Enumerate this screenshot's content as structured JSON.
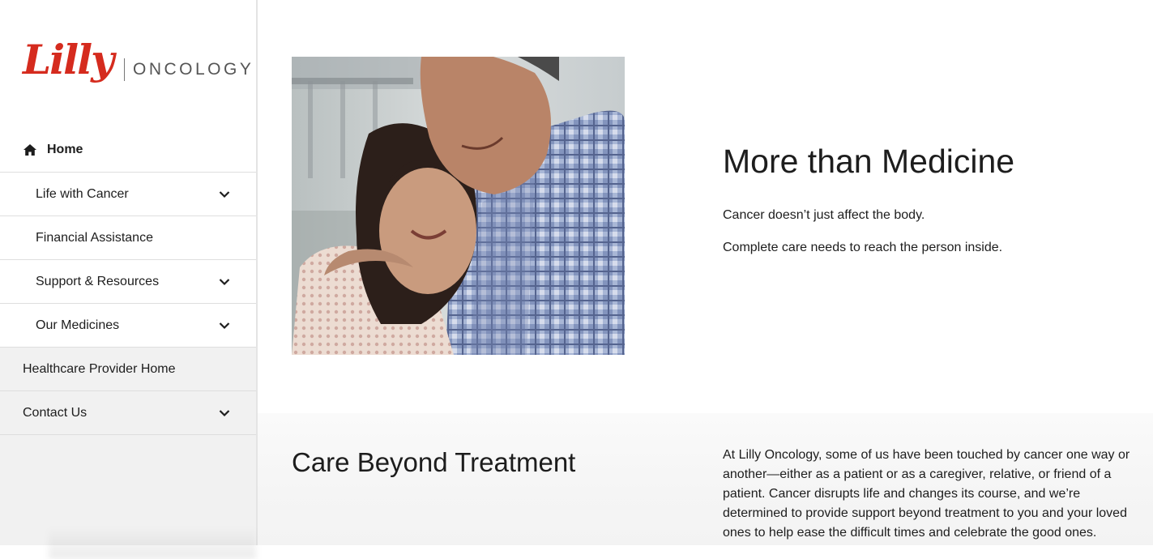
{
  "brand": {
    "logo_script": "Lilly",
    "logo_division": "ONCOLOGY",
    "brand_color": "#d52b1e"
  },
  "nav": {
    "home": {
      "label": "Home",
      "icon": "home-icon"
    },
    "items": [
      {
        "label": "Life with Cancer",
        "has_submenu": true
      },
      {
        "label": "Financial Assistance",
        "has_submenu": false
      },
      {
        "label": "Support & Resources",
        "has_submenu": true
      },
      {
        "label": "Our Medicines",
        "has_submenu": true
      },
      {
        "label": "Healthcare Provider Home",
        "has_submenu": false
      },
      {
        "label": "Contact Us",
        "has_submenu": true
      }
    ],
    "expand_icon": "chevron-down-icon"
  },
  "hero": {
    "title": "More than Medicine",
    "paragraphs": [
      "Cancer doesn’t just affect the body.",
      "Complete care needs to reach the person inside."
    ]
  },
  "care": {
    "title": "Care Beyond Treatment",
    "body": "At Lilly Oncology, some of us have been touched by cancer one way or another—either as a patient or as a caregiver, relative, or friend of a patient. Cancer disrupts life and changes its course, and we’re determined to provide support beyond treatment to you and your loved ones to help ease the difficult times and celebrate the good ones."
  }
}
